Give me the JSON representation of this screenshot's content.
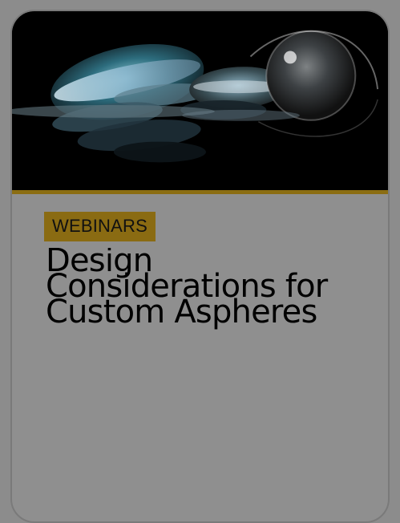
{
  "card": {
    "category_label": "WEBINARS",
    "title": "Design Considerations for Custom Aspheres"
  },
  "icons": {
    "hero": "lens-image"
  },
  "colors": {
    "accent": "#8b6d12",
    "overlay": "#8c8c8c",
    "text": "#000000"
  }
}
